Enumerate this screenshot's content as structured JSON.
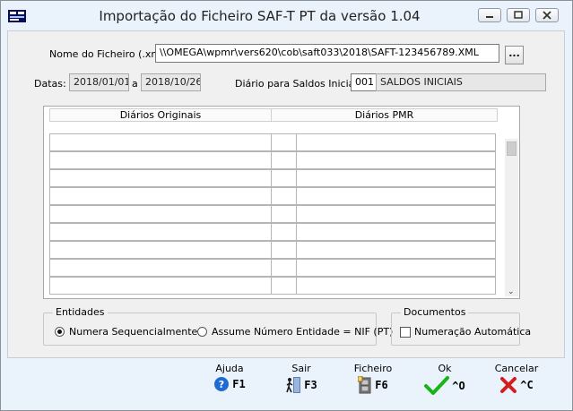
{
  "window": {
    "title": "Importação do Ficheiro SAF-T PT da versão 1.04",
    "controls": [
      "minimize-icon",
      "restore-icon",
      "close-icon"
    ]
  },
  "file": {
    "label": "Nome do Ficheiro (.xml)",
    "value": "\\\\OMEGA\\wpmr\\vers620\\cob\\saft033\\2018\\SAFT-123456789.XML",
    "browse_label": "..."
  },
  "dates": {
    "label": "Datas:",
    "from": "2018/01/01",
    "sep": "a",
    "to": "2018/10/26"
  },
  "journal": {
    "label": "Diário para Saldos Iniciais",
    "code": "001",
    "name": "SALDOS INICIAIS"
  },
  "grid": {
    "headers": [
      "Diários Originais",
      "Diários PMR"
    ],
    "rows": [
      [
        "",
        "",
        ""
      ],
      [
        "",
        "",
        ""
      ],
      [
        "",
        "",
        ""
      ],
      [
        "",
        "",
        ""
      ],
      [
        "",
        "",
        ""
      ],
      [
        "",
        "",
        ""
      ],
      [
        "",
        "",
        ""
      ],
      [
        "",
        "",
        ""
      ],
      [
        "",
        "",
        ""
      ]
    ]
  },
  "entities": {
    "title": "Entidades",
    "option1": "Numera Sequencialmente",
    "option2": "Assume Número Entidade = NIF (PT)",
    "selected": "option1"
  },
  "documents": {
    "title": "Documentos",
    "checkbox_label": "Numeração Automática",
    "checked": false
  },
  "fkeys": [
    {
      "label": "Ajuda",
      "key": "F1",
      "icon": "help-icon"
    },
    {
      "label": "Sair",
      "key": "F3",
      "icon": "exit-icon"
    },
    {
      "label": "Ficheiro",
      "key": "F6",
      "icon": "file-cabinet-icon"
    },
    {
      "label": "Ok",
      "key": "^O",
      "icon": "checkmark-icon"
    },
    {
      "label": "Cancelar",
      "key": "^C",
      "icon": "cancel-x-icon"
    }
  ],
  "colors": {
    "accent": "#1e6bd6",
    "ok": "#18b418",
    "cancel": "#d11f1f"
  }
}
